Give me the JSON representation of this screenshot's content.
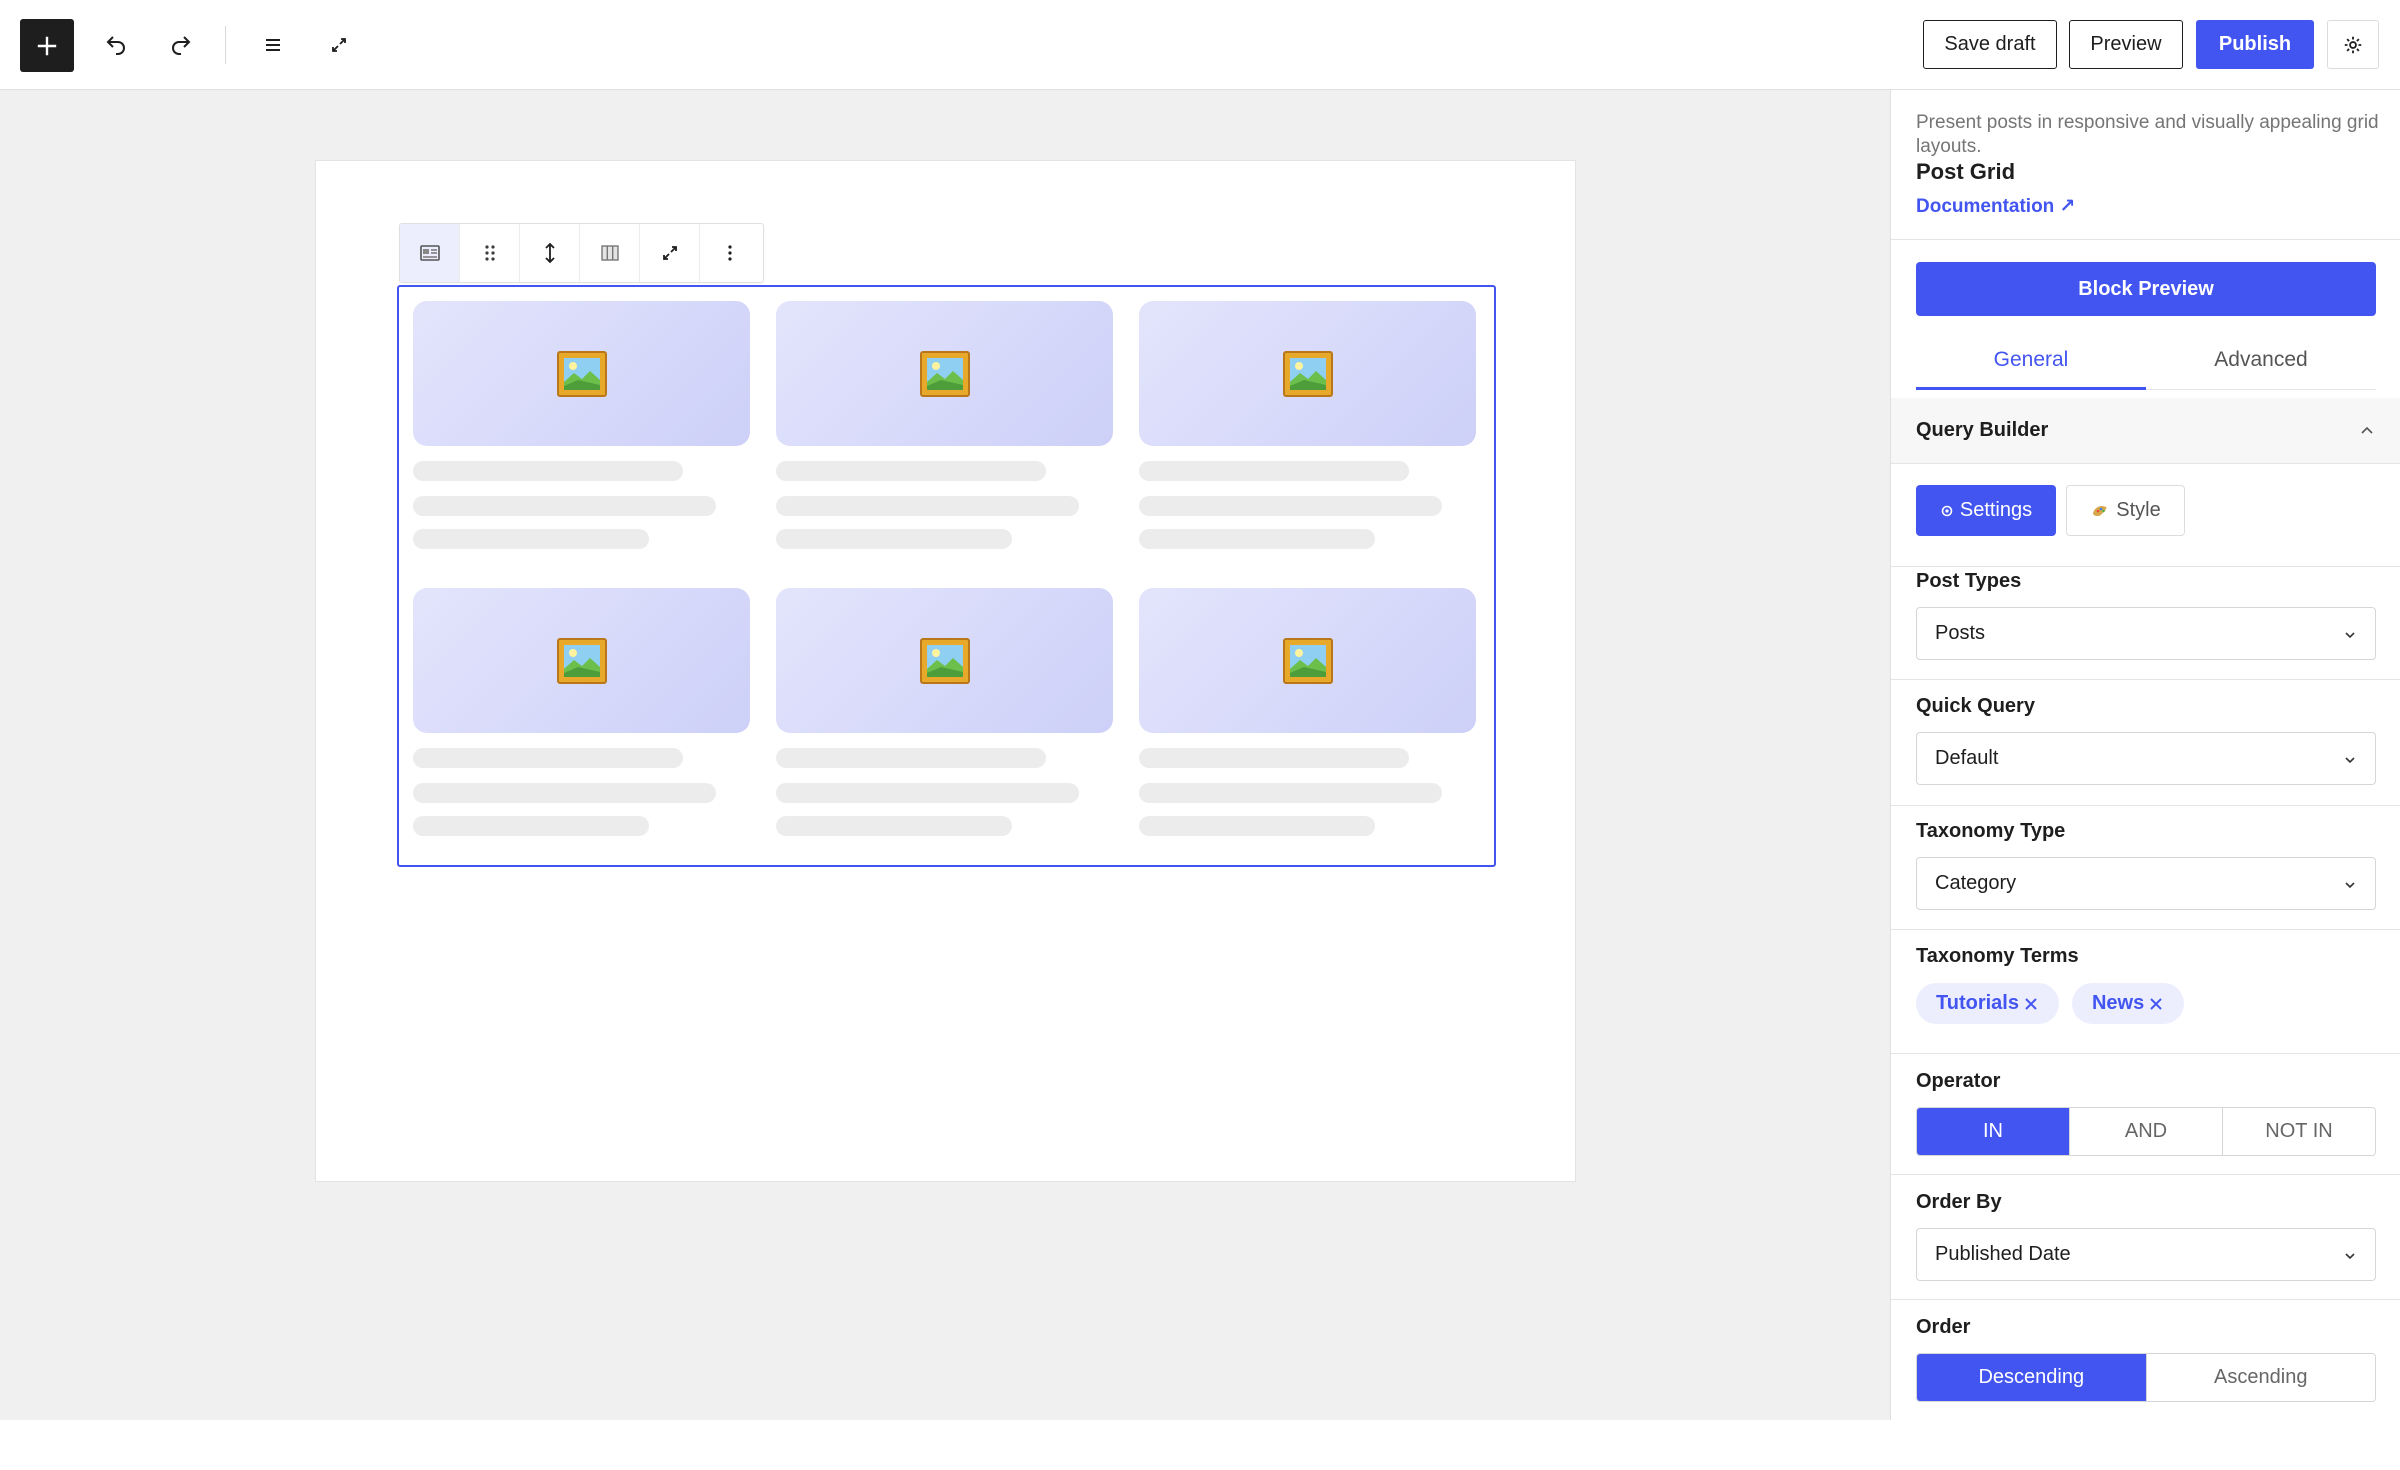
{
  "toolbar": {
    "inserter_icon": "plus-icon",
    "undo_icon": "undo-icon",
    "redo_icon": "redo-icon",
    "list_view_icon": "list-view-icon",
    "fullscreen_icon": "fullscreen-icon",
    "save_draft_label": "Save draft",
    "preview_label": "Preview",
    "publish_label": "Publish",
    "settings_icon": "gear-icon"
  },
  "block_toolbar": {
    "items": [
      "post-grid-block-icon",
      "drag-handle-icon",
      "move-up-down-icon",
      "columns-icon",
      "expand-icon",
      "more-options-icon"
    ]
  },
  "post_grid": {
    "cards": 6,
    "placeholder_icon": "framed-picture-icon"
  },
  "sidebar": {
    "description": "Present posts in responsive and visually appealing grid layouts.",
    "title": "Post Grid",
    "documentation_label": "Documentation ↗",
    "block_preview_label": "Block Preview",
    "tabs": [
      {
        "label": "General",
        "active": true
      },
      {
        "label": "Advanced",
        "active": false
      }
    ],
    "section_title": "Query Builder",
    "sub_tabs": {
      "settings_label": "Settings",
      "style_label": "Style"
    },
    "post_types": {
      "label": "Post Types",
      "value": "Posts"
    },
    "quick_query": {
      "label": "Quick Query",
      "value": "Default"
    },
    "taxonomy_type": {
      "label": "Taxonomy Type",
      "value": "Category"
    },
    "taxonomy_terms": {
      "label": "Taxonomy Terms",
      "terms": [
        "Tutorials",
        "News"
      ]
    },
    "operator": {
      "label": "Operator",
      "options": [
        "IN",
        "AND",
        "NOT IN"
      ],
      "selected": "IN"
    },
    "order_by": {
      "label": "Order By",
      "value": "Published Date"
    },
    "order": {
      "label": "Order",
      "options": [
        "Descending",
        "Ascending"
      ],
      "selected": "Descending"
    }
  },
  "colors": {
    "accent": "#4355f0",
    "accent_light": "#eceefd",
    "canvas_bg": "#f0f0f0"
  }
}
